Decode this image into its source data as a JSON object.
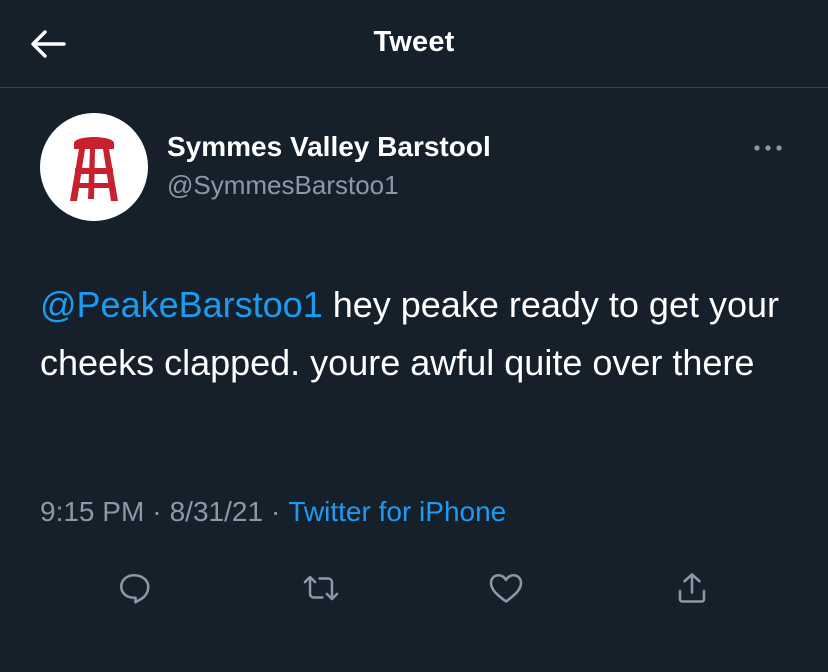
{
  "header": {
    "title": "Tweet",
    "back_icon": "arrow-left-icon"
  },
  "tweet": {
    "author": {
      "name": "Symmes Valley Barstool",
      "handle": "@SymmesBarstoo1",
      "avatar_icon": "barstool-logo-icon"
    },
    "text": {
      "mention": "@PeakeBarstoo1",
      "body": " hey peake ready to get your cheeks clapped. youre awful quite over there"
    },
    "meta": {
      "time": "9:15 PM",
      "date": "8/31/21",
      "separator": "·",
      "source": "Twitter for iPhone"
    },
    "actions": [
      "reply-icon",
      "retweet-icon",
      "like-icon",
      "share-icon"
    ]
  },
  "colors": {
    "background": "#15202b",
    "accent": "#1d9bf0",
    "secondary_text": "#8b98a5",
    "divider": "#38444d",
    "logo_red": "#c8202f"
  }
}
